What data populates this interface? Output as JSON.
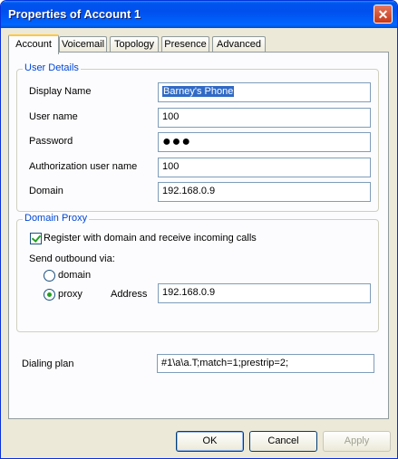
{
  "window": {
    "title": "Properties of Account 1",
    "close_glyph": "✕"
  },
  "tabs": [
    {
      "label": "Account"
    },
    {
      "label": "Voicemail"
    },
    {
      "label": "Topology"
    },
    {
      "label": "Presence"
    },
    {
      "label": "Advanced"
    }
  ],
  "user_details": {
    "title": "User Details",
    "display_name": {
      "label": "Display Name",
      "value": "Barney's Phone"
    },
    "user_name": {
      "label": "User name",
      "value": "100"
    },
    "password": {
      "label": "Password",
      "value": "●●●"
    },
    "auth_user_name": {
      "label": "Authorization user name",
      "value": "100"
    },
    "domain": {
      "label": "Domain",
      "value": "192.168.0.9"
    }
  },
  "domain_proxy": {
    "title": "Domain Proxy",
    "register_label": "Register with domain and receive incoming calls",
    "register_checked": true,
    "send_outbound_label": "Send outbound via:",
    "options": {
      "domain": "domain",
      "proxy": "proxy"
    },
    "selected": "proxy",
    "address_label": "Address",
    "address_value": "192.168.0.9"
  },
  "dialing_plan": {
    "label": "Dialing plan",
    "value": "#1\\a\\a.T;match=1;prestrip=2;"
  },
  "buttons": {
    "ok": "OK",
    "cancel": "Cancel",
    "apply": "Apply"
  }
}
